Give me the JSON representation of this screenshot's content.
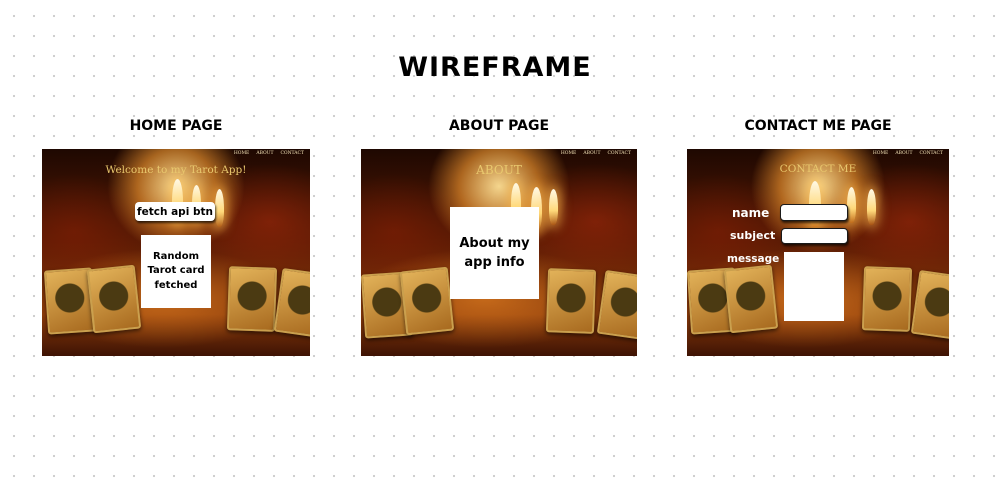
{
  "title": "WIREFRAME",
  "home": {
    "label": "HOME PAGE",
    "nav": [
      "HOME",
      "ABOUT",
      "CONTACT"
    ],
    "heading": "Welcome to my Tarot App!",
    "fetch_button": "fetch api btn",
    "card_text": "Random Tarot card fetched"
  },
  "about": {
    "label": "ABOUT PAGE",
    "nav": [
      "HOME",
      "ABOUT",
      "CONTACT"
    ],
    "heading": "ABOUT",
    "info_text": "About my app info"
  },
  "contact": {
    "label": "CONTACT ME PAGE",
    "nav": [
      "HOME",
      "ABOUT",
      "CONTACT"
    ],
    "heading": "CONTACT ME",
    "fields": {
      "name": "name",
      "subject": "subject",
      "message": "message"
    }
  }
}
